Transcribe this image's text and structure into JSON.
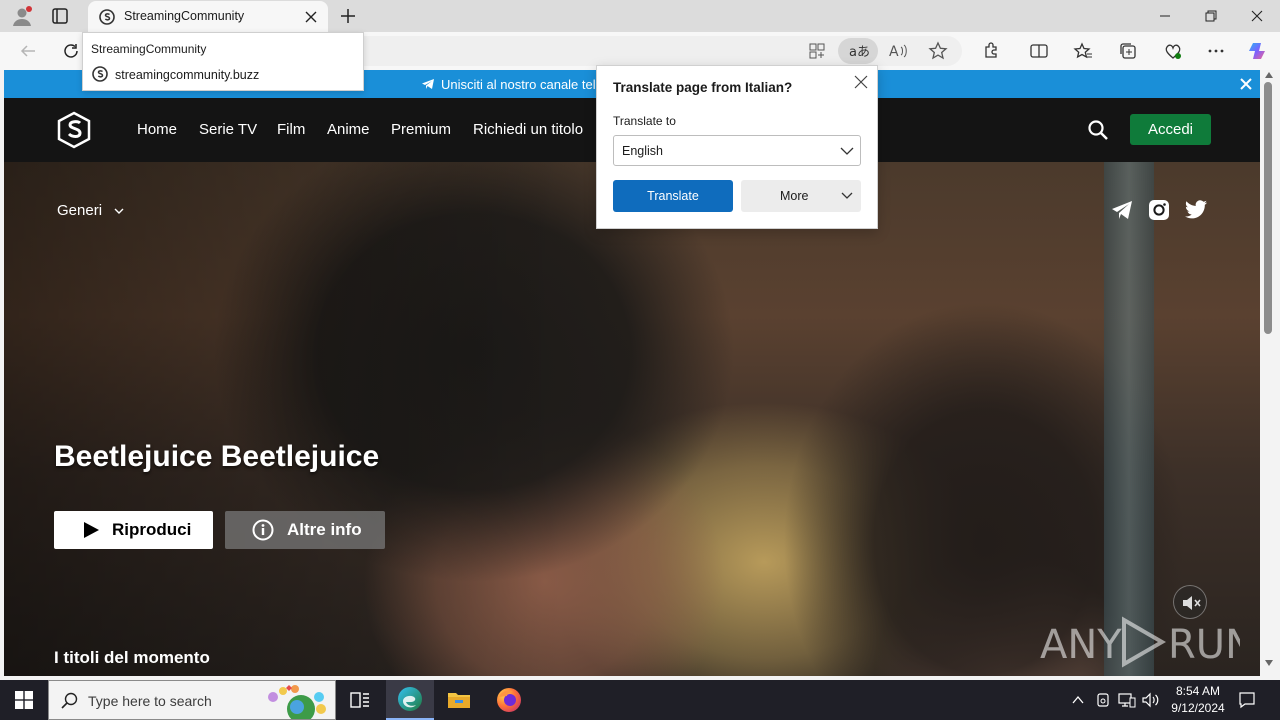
{
  "browser": {
    "tab_title": "StreamingCommunity",
    "suggestion_title": "StreamingCommunity",
    "suggestion_url": "streamingcommunity.buzz"
  },
  "banner": {
    "text": "Unisciti al nostro canale tel"
  },
  "nav": {
    "links": [
      "Home",
      "Serie TV",
      "Film",
      "Anime",
      "Premium",
      "Richiedi un titolo"
    ],
    "login": "Accedi"
  },
  "hero": {
    "genres": "Generi",
    "title": "Beetlejuice Beetlejuice",
    "play": "Riproduci",
    "info": "Altre info",
    "section": "I titoli del momento",
    "watermark": "ANY RUN"
  },
  "translate_popup": {
    "heading": "Translate page from Italian?",
    "label": "Translate to",
    "selected_language": "English",
    "translate_button": "Translate",
    "more_button": "More"
  },
  "taskbar": {
    "search_placeholder": "Type here to search",
    "time": "8:54 AM",
    "date": "9/12/2024"
  },
  "colors": {
    "banner": "#1a8fd8",
    "login_button": "#0f7b3a",
    "translate_button": "#0f6cbd"
  }
}
